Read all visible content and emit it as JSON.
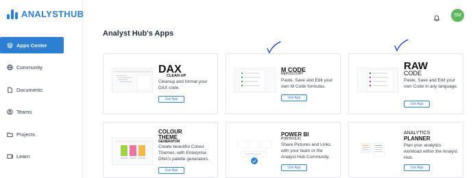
{
  "brand": {
    "name": "ANALYSTHUB"
  },
  "nav": {
    "items": [
      {
        "label": "Apps Center",
        "icon": "layers-icon",
        "active": true
      },
      {
        "label": "Community",
        "icon": "globe-icon",
        "active": false
      },
      {
        "label": "Documents",
        "icon": "document-icon",
        "active": false
      },
      {
        "label": "Teams",
        "icon": "team-icon",
        "active": false
      },
      {
        "label": "Projects",
        "icon": "folder-icon",
        "active": false
      },
      {
        "label": "Learn",
        "icon": "learn-icon",
        "active": false
      }
    ]
  },
  "header": {
    "avatar_initials": "SM",
    "avatar_color": "#5cb85c",
    "accent": "#2b7fd4"
  },
  "main": {
    "title": "Analyst Hub's Apps",
    "cards": [
      {
        "brand_main": "DAX",
        "brand_sub": "CLEAN UP",
        "description": "Cleanup and format your DAX code.",
        "button": "Use App"
      },
      {
        "brand_main": "M CODE",
        "brand_sub": "REPOSITORY",
        "description": "Paste, Save and Edit your own M Code formulas.",
        "button": "Use App"
      },
      {
        "brand_main": "RAW",
        "brand_sub": "CODE",
        "description": "Paste, Save and Edit your own Code in any language.",
        "button": "Use App"
      },
      {
        "brand_main": "COLOUR",
        "brand_mid": "THEME",
        "brand_sub": "GENERATOR",
        "description": "Create beautiful Colour Themes, with Enterprise DNA's palette generators.",
        "button": "Use App"
      },
      {
        "brand_main": "POWER BI",
        "brand_sub": "PORTFOLIO",
        "description": "Share Pictures and Links with your team or the Analyst Hub Community.",
        "button": "Use App"
      },
      {
        "brand_main": "ANALYTICS",
        "brand_sub": "PLANNER",
        "description": "Plan your analytics workload within the Analyst Hub.",
        "button": "Use App"
      }
    ]
  }
}
